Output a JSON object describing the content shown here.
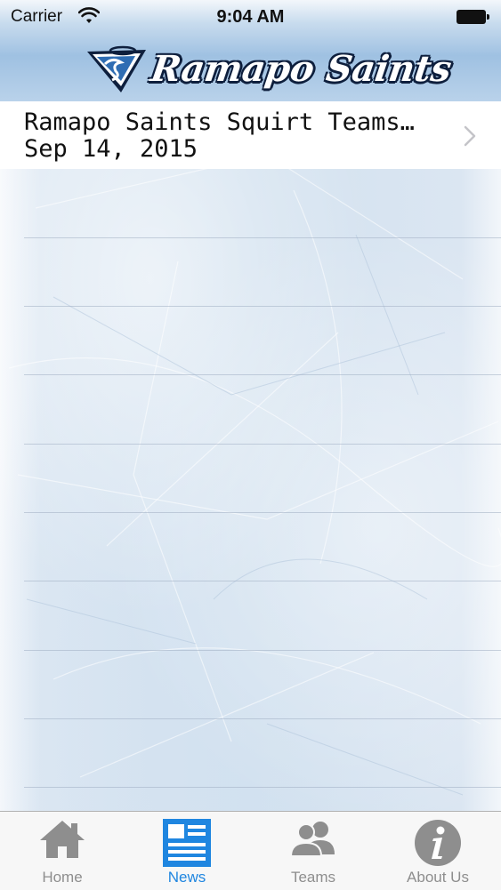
{
  "status_bar": {
    "carrier": "Carrier",
    "time": "9:04 AM"
  },
  "header": {
    "logo_text": "Ramapo Saints",
    "logo_icon": "saints-emblem-icon"
  },
  "news": {
    "items": [
      {
        "title": "Ramapo Saints Squirt Teams…",
        "date": "Sep 14, 2015"
      }
    ]
  },
  "tab_bar": {
    "tabs": [
      {
        "label": "Home",
        "icon": "house-icon",
        "active": false
      },
      {
        "label": "News",
        "icon": "newspaper-icon",
        "active": true
      },
      {
        "label": "Teams",
        "icon": "people-icon",
        "active": false
      },
      {
        "label": "About Us",
        "icon": "info-icon",
        "active": false
      }
    ]
  },
  "colors": {
    "tab_active": "#1f86e0",
    "tab_inactive": "#8e8e8e",
    "header_blue": "#9fc1e2"
  }
}
